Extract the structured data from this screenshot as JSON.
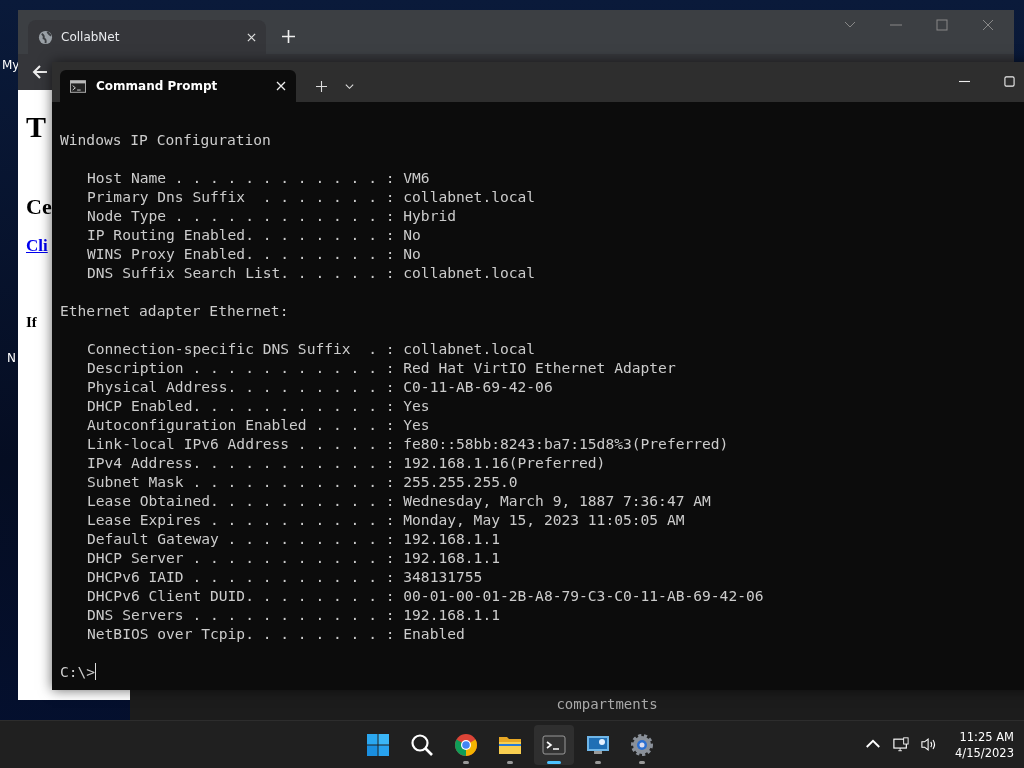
{
  "desktop_icons": [
    {
      "label": "My"
    },
    {
      "label": "N"
    }
  ],
  "browser": {
    "tab_title": "CollabNet",
    "page_texts": [
      {
        "kind": "h1",
        "text": "T"
      },
      {
        "kind": "h2",
        "text": "Ce"
      },
      {
        "kind": "link",
        "text": "Cli"
      },
      {
        "kind": "para",
        "text": "If"
      }
    ]
  },
  "background_window": {
    "text": "compartments"
  },
  "terminal": {
    "tab_title": "Command Prompt",
    "sections": [
      {
        "heading": "Windows IP Configuration",
        "entries": [
          "Host Name . . . . . . . . . . . . : VM6",
          "Primary Dns Suffix  . . . . . . . : collabnet.local",
          "Node Type . . . . . . . . . . . . : Hybrid",
          "IP Routing Enabled. . . . . . . . : No",
          "WINS Proxy Enabled. . . . . . . . : No",
          "DNS Suffix Search List. . . . . . : collabnet.local"
        ]
      },
      {
        "heading": "Ethernet adapter Ethernet:",
        "entries": [
          "Connection-specific DNS Suffix  . : collabnet.local",
          "Description . . . . . . . . . . . : Red Hat VirtIO Ethernet Adapter",
          "Physical Address. . . . . . . . . : C0-11-AB-69-42-06",
          "DHCP Enabled. . . . . . . . . . . : Yes",
          "Autoconfiguration Enabled . . . . : Yes",
          "Link-local IPv6 Address . . . . . : fe80::58bb:8243:ba7:15d8%3(Preferred)",
          "IPv4 Address. . . . . . . . . . . : 192.168.1.16(Preferred)",
          "Subnet Mask . . . . . . . . . . . : 255.255.255.0",
          "Lease Obtained. . . . . . . . . . : Wednesday, March 9, 1887 7:36:47 AM",
          "Lease Expires . . . . . . . . . . : Monday, May 15, 2023 11:05:05 AM",
          "Default Gateway . . . . . . . . . : 192.168.1.1",
          "DHCP Server . . . . . . . . . . . : 192.168.1.1",
          "DHCPv6 IAID . . . . . . . . . . . : 348131755",
          "DHCPv6 Client DUID. . . . . . . . : 00-01-00-01-2B-A8-79-C3-C0-11-AB-69-42-06",
          "DNS Servers . . . . . . . . . . . : 192.168.1.1",
          "NetBIOS over Tcpip. . . . . . . . : Enabled"
        ]
      }
    ],
    "prompt": "C:\\>"
  },
  "taskbar": {
    "apps": [
      {
        "kind": "start",
        "running": false,
        "selected": false
      },
      {
        "kind": "search",
        "running": false,
        "selected": false
      },
      {
        "kind": "chrome",
        "running": true,
        "selected": false
      },
      {
        "kind": "folder",
        "running": true,
        "selected": false
      },
      {
        "kind": "terminal",
        "running": true,
        "selected": true
      },
      {
        "kind": "remote",
        "running": true,
        "selected": false
      },
      {
        "kind": "settings",
        "running": true,
        "selected": false
      }
    ],
    "clock": {
      "time": "11:25 AM",
      "date": "4/15/2023"
    }
  }
}
